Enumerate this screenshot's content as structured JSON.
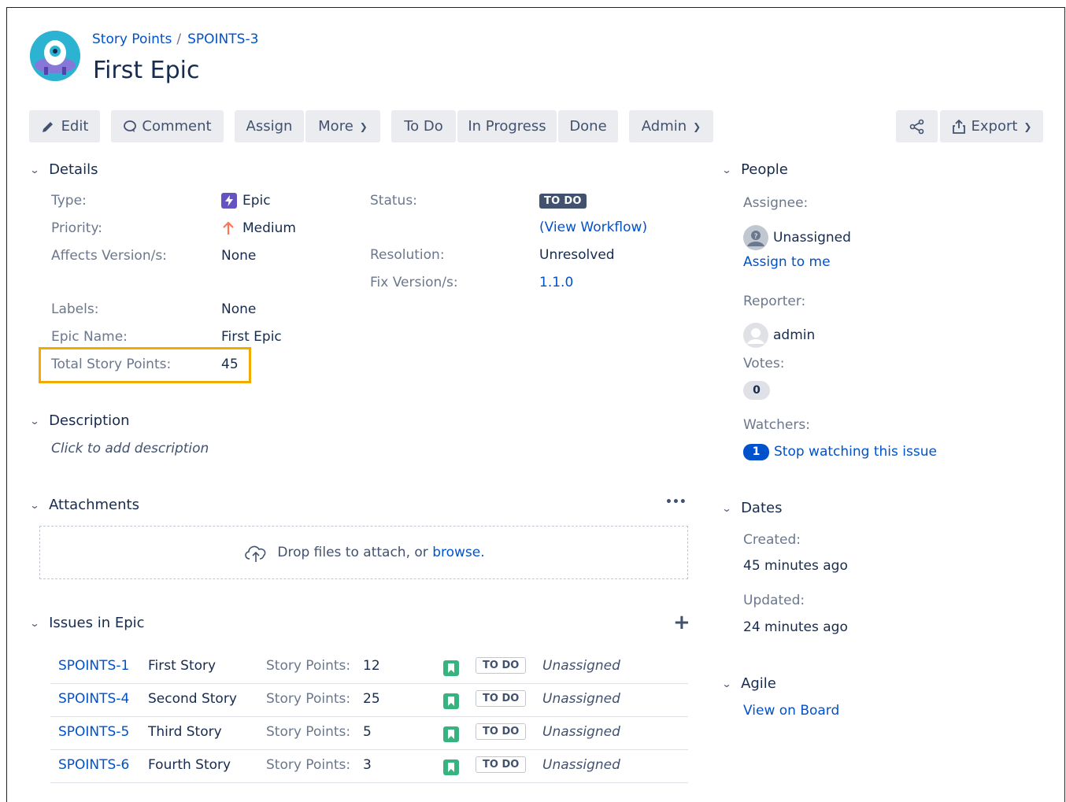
{
  "breadcrumb": {
    "project": "Story Points",
    "separator": "/",
    "issue_key": "SPOINTS-3"
  },
  "title": "First Epic",
  "toolbar": {
    "edit": "Edit",
    "comment": "Comment",
    "assign": "Assign",
    "more": "More",
    "todo": "To Do",
    "in_progress": "In Progress",
    "done": "Done",
    "admin": "Admin",
    "export": "Export"
  },
  "details": {
    "heading": "Details",
    "type_label": "Type:",
    "type_value": "Epic",
    "priority_label": "Priority:",
    "priority_value": "Medium",
    "affects_label": "Affects Version/s:",
    "affects_value": "None",
    "status_label": "Status:",
    "status_value": "TO DO",
    "view_workflow": "(View Workflow)",
    "resolution_label": "Resolution:",
    "resolution_value": "Unresolved",
    "fix_label": "Fix Version/s:",
    "fix_value": "1.1.0",
    "labels_label": "Labels:",
    "labels_value": "None",
    "epic_name_label": "Epic Name:",
    "epic_name_value": "First Epic",
    "total_sp_label": "Total Story Points:",
    "total_sp_value": "45"
  },
  "description": {
    "heading": "Description",
    "placeholder": "Click to add description"
  },
  "attachments": {
    "heading": "Attachments",
    "more": "•••",
    "drop_text": "Drop files to attach, or ",
    "browse": "browse."
  },
  "issues_in_epic": {
    "heading": "Issues in Epic",
    "add": "+",
    "rows": [
      {
        "key": "SPOINTS-1",
        "summary": "First Story",
        "sp_label": "Story Points:",
        "sp": "12",
        "status": "TO DO",
        "assignee": "Unassigned"
      },
      {
        "key": "SPOINTS-4",
        "summary": "Second Story",
        "sp_label": "Story Points:",
        "sp": "25",
        "status": "TO DO",
        "assignee": "Unassigned"
      },
      {
        "key": "SPOINTS-5",
        "summary": "Third Story",
        "sp_label": "Story Points:",
        "sp": "5",
        "status": "TO DO",
        "assignee": "Unassigned"
      },
      {
        "key": "SPOINTS-6",
        "summary": "Fourth Story",
        "sp_label": "Story Points:",
        "sp": "3",
        "status": "TO DO",
        "assignee": "Unassigned"
      }
    ]
  },
  "people": {
    "heading": "People",
    "assignee_label": "Assignee:",
    "assignee_value": "Unassigned",
    "assign_to_me": "Assign to me",
    "reporter_label": "Reporter:",
    "reporter_value": "admin",
    "votes_label": "Votes:",
    "votes_value": "0",
    "watchers_label": "Watchers:",
    "watchers_count": "1",
    "stop_watching": "Stop watching this issue"
  },
  "dates": {
    "heading": "Dates",
    "created_label": "Created:",
    "created_value": "45 minutes ago",
    "updated_label": "Updated:",
    "updated_value": "24 minutes ago"
  },
  "agile": {
    "heading": "Agile",
    "view_on_board": "View on Board"
  },
  "colors": {
    "link": "#0052cc",
    "highlight": "#f0ab00",
    "epic": "#6554c0",
    "story": "#36b37e",
    "priority": "#ff7452"
  }
}
